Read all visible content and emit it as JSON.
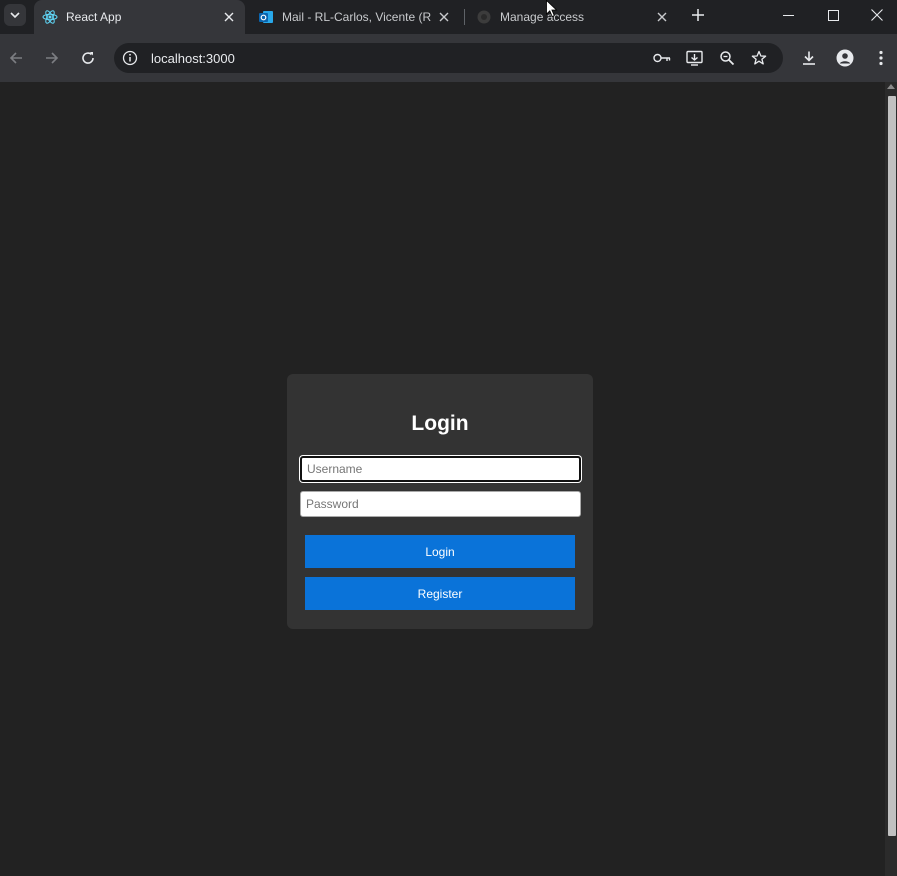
{
  "browser": {
    "tabs": [
      {
        "title": "React App",
        "active": true,
        "favicon": "react-icon"
      },
      {
        "title": "Mail - RL-Carlos, Vicente (R",
        "active": false,
        "favicon": "outlook-icon"
      },
      {
        "title": "Manage access",
        "active": false,
        "favicon": "github-icon"
      }
    ],
    "address": "localhost:3000"
  },
  "login": {
    "title": "Login",
    "username_placeholder": "Username",
    "password_placeholder": "Password",
    "login_label": "Login",
    "register_label": "Register"
  },
  "colors": {
    "page_bg": "#222222",
    "card_bg": "#333333",
    "button": "#0a73d9"
  }
}
